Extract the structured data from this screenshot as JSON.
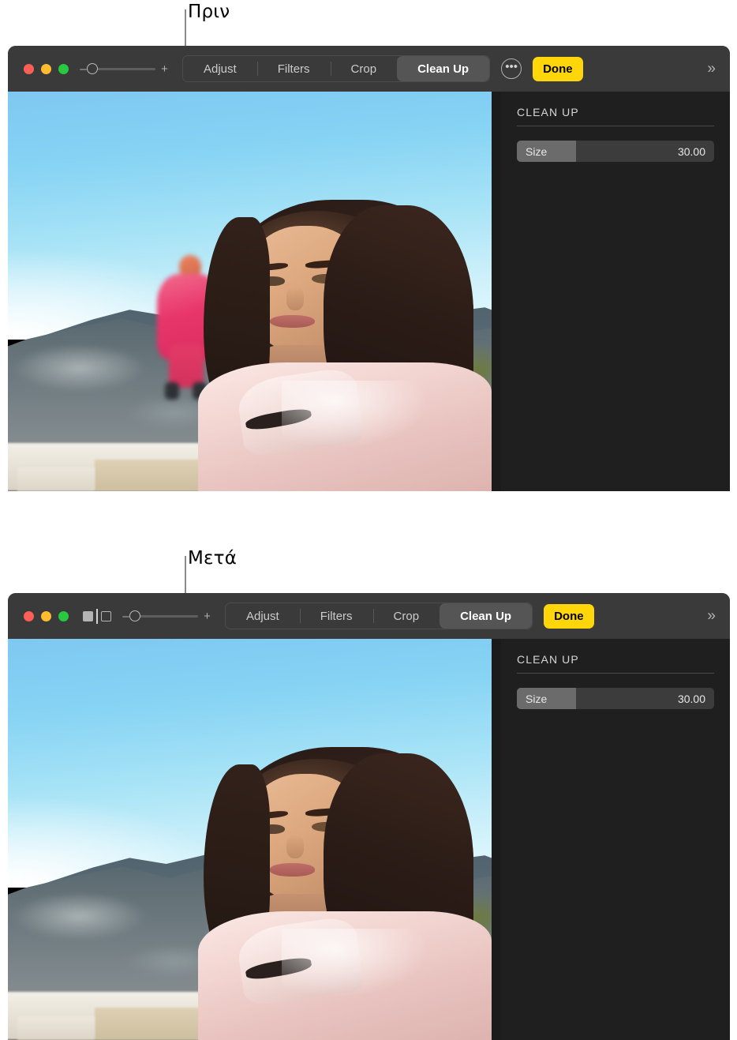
{
  "callouts": [
    {
      "id": "before",
      "label": "Πριν"
    },
    {
      "id": "after",
      "label": "Μετά"
    }
  ],
  "windows": [
    {
      "id": "before-window",
      "traffic_lights": [
        {
          "name": "close",
          "color": "#ff5f57"
        },
        {
          "name": "minimize",
          "color": "#febc2e"
        },
        {
          "name": "zoom",
          "color": "#28c840"
        }
      ],
      "has_compare_toggle": false,
      "zoom_slider": {
        "minus": "–",
        "plus": "+",
        "value": 0
      },
      "tabs": [
        {
          "label": "Adjust",
          "selected": false
        },
        {
          "label": "Filters",
          "selected": false
        },
        {
          "label": "Crop",
          "selected": false
        },
        {
          "label": "Clean Up",
          "selected": true
        }
      ],
      "has_more_button": true,
      "more_label": "•••",
      "done_label": "Done",
      "done_color": "#ffd60a",
      "expand_label": "»",
      "panel": {
        "title": "CLEAN UP",
        "slider": {
          "label": "Size",
          "value": "30.00",
          "fill_percent": 30
        }
      },
      "photo": {
        "subject_removed": false
      }
    },
    {
      "id": "after-window",
      "traffic_lights": [
        {
          "name": "close",
          "color": "#ff5f57"
        },
        {
          "name": "minimize",
          "color": "#febc2e"
        },
        {
          "name": "zoom",
          "color": "#28c840"
        }
      ],
      "has_compare_toggle": true,
      "zoom_slider": {
        "minus": "–",
        "plus": "+",
        "value": 0
      },
      "tabs": [
        {
          "label": "Adjust",
          "selected": false
        },
        {
          "label": "Filters",
          "selected": false
        },
        {
          "label": "Crop",
          "selected": false
        },
        {
          "label": "Clean Up",
          "selected": true
        }
      ],
      "has_more_button": false,
      "more_label": "",
      "done_label": "Done",
      "done_color": "#ffd60a",
      "expand_label": "»",
      "panel": {
        "title": "CLEAN UP",
        "slider": {
          "label": "Size",
          "value": "30.00",
          "fill_percent": 30
        }
      },
      "photo": {
        "subject_removed": true
      }
    }
  ]
}
